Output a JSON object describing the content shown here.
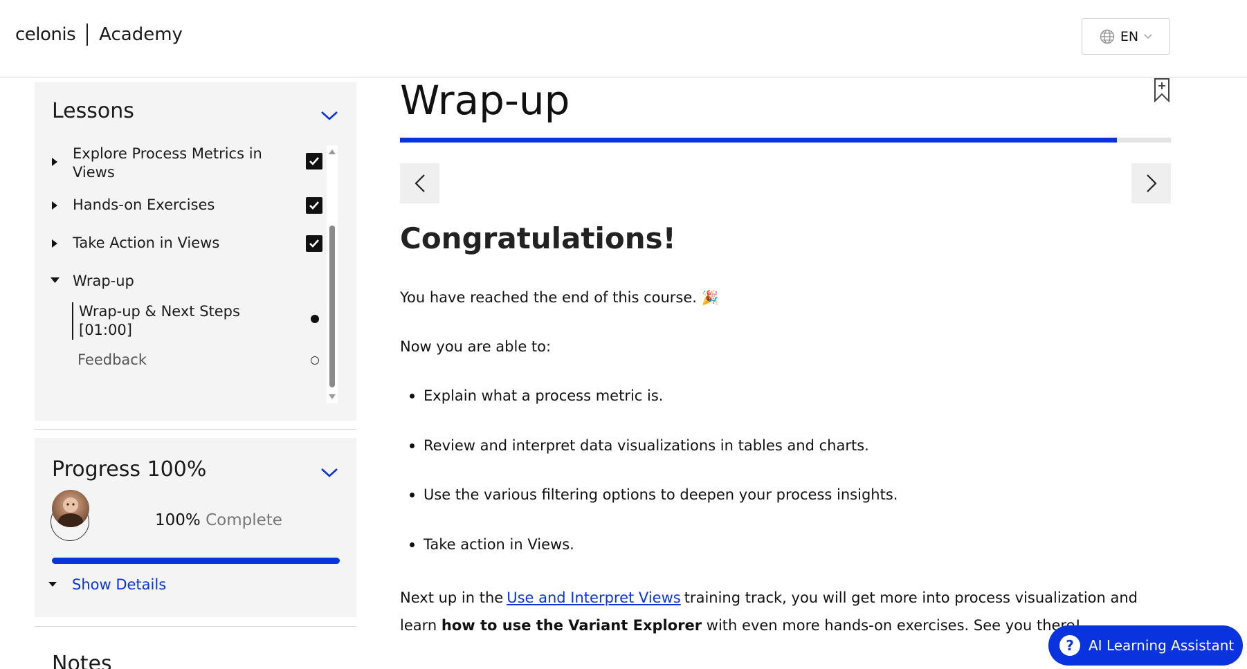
{
  "header": {
    "logo": "celonis",
    "academy": "Academy",
    "language": "EN"
  },
  "sidebar": {
    "lessons_title": "Lessons",
    "lessons": [
      {
        "label": "Explore Process Metrics in Views",
        "completed": true
      },
      {
        "label": "Hands-on Exercises",
        "completed": true
      },
      {
        "label": "Take Action in Views",
        "completed": true
      },
      {
        "label": "Wrap-up",
        "expanded": true
      }
    ],
    "sub_lessons": [
      {
        "label": "Wrap-up & Next Steps [01:00]",
        "status": "current"
      },
      {
        "label": "Feedback",
        "status": "not-started"
      }
    ],
    "progress": {
      "title": "Progress 100%",
      "percent_text": "100%",
      "complete_word": "Complete",
      "value": 1.0,
      "show_details": "Show Details"
    },
    "notes_title": "Notes"
  },
  "main": {
    "title": "Wrap-up",
    "course_progress": 0.93,
    "heading": "Congratulations!",
    "intro": "You have reached the end of this course.",
    "intro_emoji": "🎉",
    "able_to": "Now you are able to:",
    "objectives": [
      "Explain what a process metric is.",
      "Review and interpret data visualizations in tables and charts.",
      "Use the various filtering options to deepen your process insights.",
      "Take action in Views."
    ],
    "next_up": {
      "before": "Next up in the",
      "link": "Use and Interpret Views",
      "middle": "training track, you will get more into process visualization and learn",
      "bold": "how to use the Variant Explorer",
      "after": "with even more hands-on exercises. See you there!"
    }
  },
  "assistant": {
    "label": "AI Learning Assistant"
  },
  "colors": {
    "accent": "#0a33e0",
    "panel_bg": "#f4f4f4"
  }
}
